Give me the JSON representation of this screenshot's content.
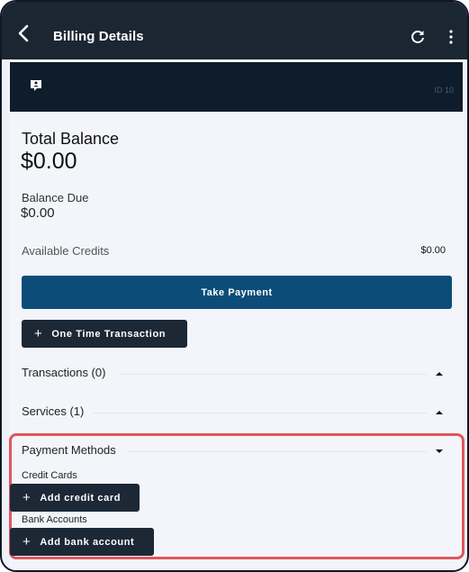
{
  "app_bar": {
    "title": "Billing Details",
    "back_icon": "chevron-left-icon",
    "refresh_icon": "refresh-icon",
    "menu_icon": "more-vert-icon"
  },
  "banner": {
    "icon": "message-badge-icon",
    "id_text": "ID 10"
  },
  "balance": {
    "total_label": "Total Balance",
    "total_value": "$0.00",
    "due_label": "Balance Due",
    "due_value": "$0.00",
    "credits_label": "Available Credits",
    "credits_value": "$0.00"
  },
  "actions": {
    "take_payment": "Take Payment",
    "one_time": "One Time Transaction",
    "plus_icon": "+"
  },
  "sections": {
    "transactions": "Transactions (0)",
    "services": "Services (1)",
    "payment_methods": "Payment Methods"
  },
  "payment_methods": {
    "credit_cards_label": "Credit Cards",
    "add_credit_card": "Add credit card",
    "bank_accounts_label": "Bank Accounts",
    "add_bank_account": "Add bank account"
  },
  "colors": {
    "app_bar": "#1b2633",
    "banner": "#0e1c2b",
    "primary_button": "#0b4d78",
    "dark_button": "#1c2836",
    "highlight_border": "#e0555d"
  }
}
